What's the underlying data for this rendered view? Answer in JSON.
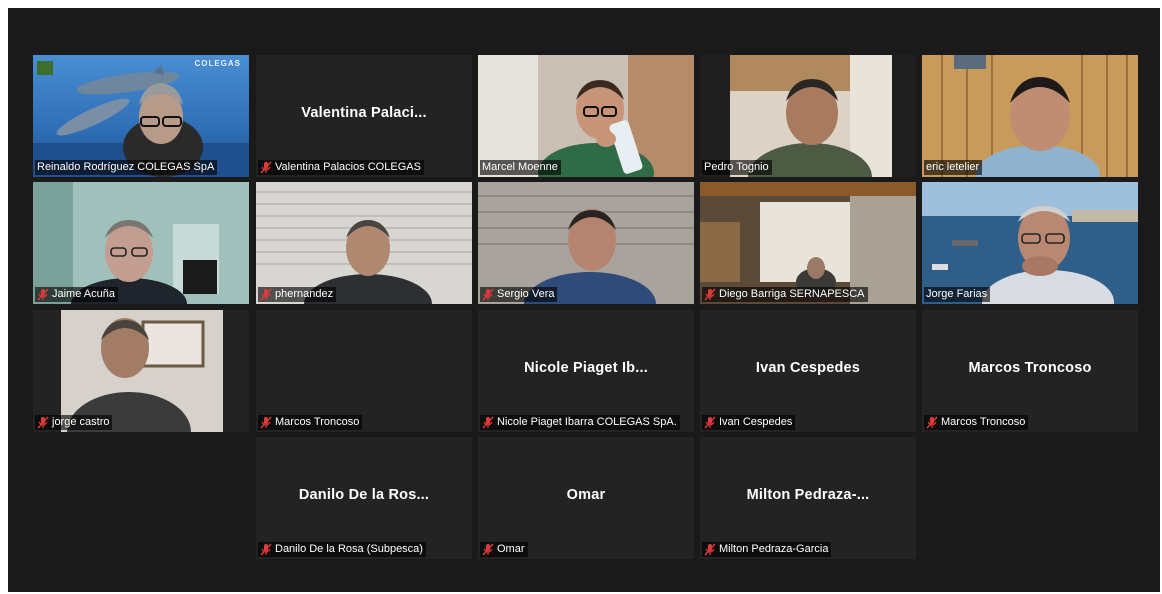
{
  "colors": {
    "background": "#1a1a1a",
    "tile": "#232323",
    "active_speaker_border": "#d6e05a",
    "muted_icon": "#e03a3a"
  },
  "tiles": [
    {
      "display_name": "",
      "label": "Reinaldo Rodríguez  COLEGAS SpA",
      "muted": false,
      "video": true,
      "watermark": "COLEGAS",
      "icon": "video-feed"
    },
    {
      "display_name": "Valentina  Palaci...",
      "label": "Valentina Palacios COLEGAS",
      "muted": true,
      "video": false
    },
    {
      "display_name": "",
      "label": "Marcel Moenne",
      "muted": false,
      "video": true
    },
    {
      "display_name": "",
      "label": "Pedro Tognio",
      "muted": false,
      "video": true,
      "active_speaker": true
    },
    {
      "display_name": "",
      "label": "eric letelier",
      "muted": false,
      "video": true
    },
    {
      "display_name": "",
      "label": "Jaime Acuña",
      "muted": true,
      "video": true
    },
    {
      "display_name": "",
      "label": "phernandez",
      "muted": true,
      "video": true
    },
    {
      "display_name": "",
      "label": "Sergio Vera",
      "muted": true,
      "video": true
    },
    {
      "display_name": "",
      "label": "Diego Barriga SERNAPESCA",
      "muted": true,
      "video": true
    },
    {
      "display_name": "",
      "label": "Jorge Farias",
      "muted": false,
      "video": true
    },
    {
      "display_name": "",
      "label": "jorge castro",
      "muted": true,
      "video": true
    },
    {
      "display_name": "",
      "label": "Marcos Troncoso",
      "muted": true,
      "video": false
    },
    {
      "display_name": "Nicole  Piaget  Ib...",
      "label": "Nicole Piaget Ibarra COLEGAS SpA.",
      "muted": true,
      "video": false
    },
    {
      "display_name": "Ivan  Cespedes",
      "label": "Ivan Cespedes",
      "muted": true,
      "video": false
    },
    {
      "display_name": "Marcos  Troncoso",
      "label": "Marcos Troncoso",
      "muted": true,
      "video": false
    },
    {
      "display_name": "Danilo  De  la  Ros...",
      "label": "Danilo De la Rosa (Subpesca)",
      "muted": true,
      "video": false
    },
    {
      "display_name": "Omar",
      "label": "Omar",
      "muted": true,
      "video": false
    },
    {
      "display_name": "Milton  Pedraza-...",
      "label": "Milton Pedraza-Garcia",
      "muted": true,
      "video": false
    }
  ]
}
